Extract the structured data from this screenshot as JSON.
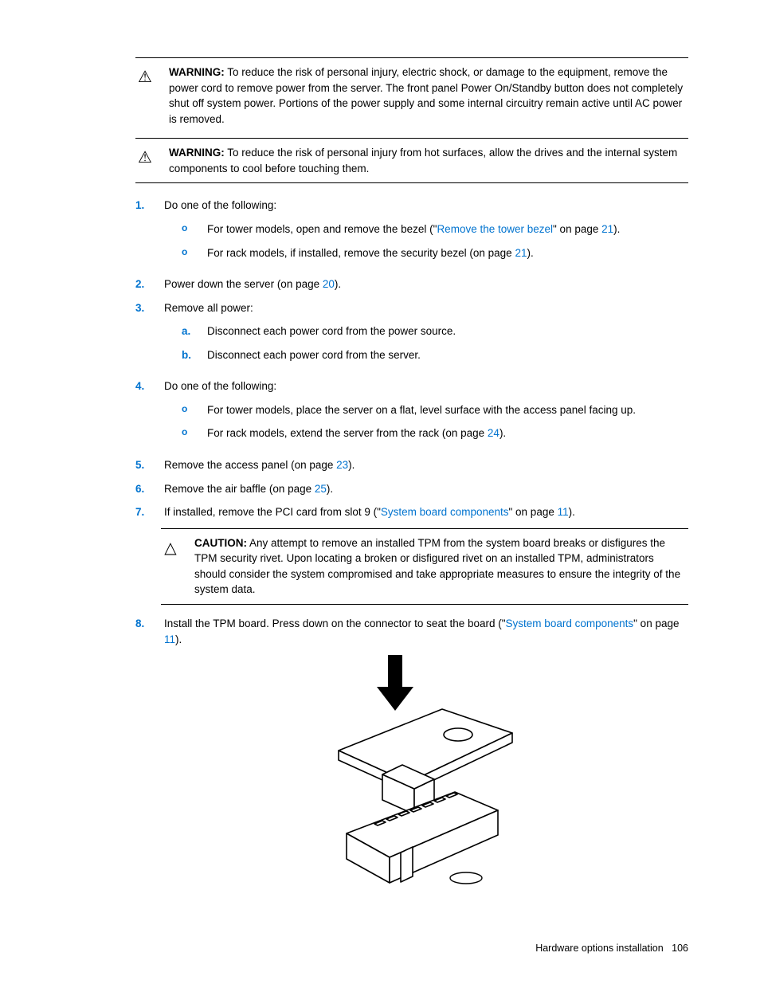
{
  "alerts": {
    "warning1": {
      "label": "WARNING:",
      "text": "To reduce the risk of personal injury, electric shock, or damage to the equipment, remove the power cord to remove power from the server. The front panel Power On/Standby button does not completely shut off system power. Portions of the power supply and some internal circuitry remain active until AC power is removed."
    },
    "warning2": {
      "label": "WARNING:",
      "text": "To reduce the risk of personal injury from hot surfaces, allow the drives and the internal system components to cool before touching them."
    },
    "caution": {
      "label": "CAUTION:",
      "text": "Any attempt to remove an installed TPM from the system board breaks or disfigures the TPM security rivet. Upon locating a broken or disfigured rivet on an installed TPM, administrators should consider the system compromised and take appropriate measures to ensure the integrity of the system data."
    }
  },
  "steps": {
    "s1": {
      "num": "1.",
      "text": "Do one of the following:",
      "sub": {
        "a": {
          "bullet": "o",
          "pre": "For tower models, open and remove the bezel (\"",
          "link": "Remove the tower bezel",
          "mid": "\" on page ",
          "page": "21",
          "post": ")."
        },
        "b": {
          "bullet": "o",
          "pre": "For rack models, if installed, remove the security bezel (on page ",
          "page": "21",
          "post": ")."
        }
      }
    },
    "s2": {
      "num": "2.",
      "pre": "Power down the server (on page ",
      "page": "20",
      "post": ")."
    },
    "s3": {
      "num": "3.",
      "text": "Remove all power:",
      "sub": {
        "a": {
          "letter": "a.",
          "text": "Disconnect each power cord from the power source."
        },
        "b": {
          "letter": "b.",
          "text": "Disconnect each power cord from the server."
        }
      }
    },
    "s4": {
      "num": "4.",
      "text": "Do one of the following:",
      "sub": {
        "a": {
          "bullet": "o",
          "text": "For tower models, place the server on a flat, level surface with the access panel facing up."
        },
        "b": {
          "bullet": "o",
          "pre": "For rack models, extend the server from the rack (on page ",
          "page": "24",
          "post": ")."
        }
      }
    },
    "s5": {
      "num": "5.",
      "pre": "Remove the access panel (on page ",
      "page": "23",
      "post": ")."
    },
    "s6": {
      "num": "6.",
      "pre": "Remove the air baffle (on page ",
      "page": "25",
      "post": ")."
    },
    "s7": {
      "num": "7.",
      "pre": "If installed, remove the PCI card from slot 9 (\"",
      "link": "System board components",
      "mid": "\" on page ",
      "page": "11",
      "post": ")."
    },
    "s8": {
      "num": "8.",
      "pre": "Install the TPM board. Press down on the connector to seat the board (\"",
      "link": "System board components",
      "mid": "\" on page ",
      "page": "11",
      "post": ")."
    }
  },
  "figure": {
    "name": "tpm-board-install-diagram"
  },
  "footer": {
    "section": "Hardware options installation",
    "page": "106"
  }
}
